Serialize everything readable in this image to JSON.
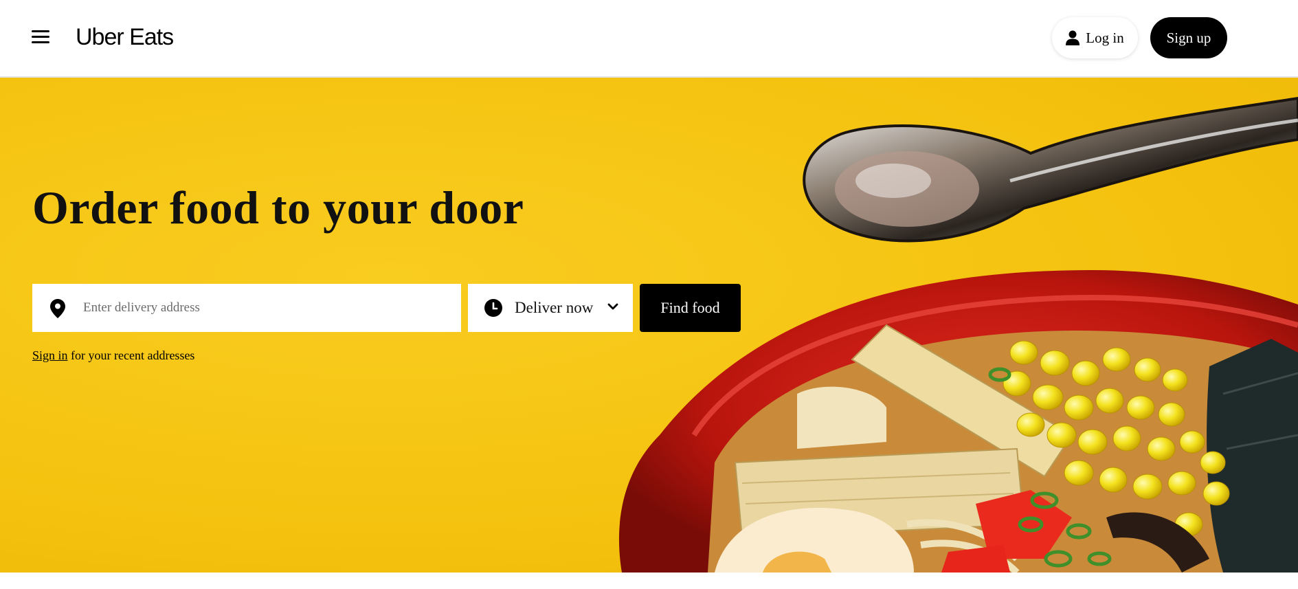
{
  "header": {
    "brand": "Uber Eats",
    "login_label": "Log in",
    "signup_label": "Sign up",
    "menu_icon": "hamburger-menu-icon",
    "login_icon": "person-icon"
  },
  "hero": {
    "title": "Order food to your door",
    "address_placeholder": "Enter delivery address",
    "address_value": "",
    "address_icon": "location-pin-icon",
    "time_label": "Deliver now",
    "time_icon": "clock-icon",
    "time_dropdown_icon": "chevron-down-icon",
    "find_label": "Find food",
    "signin_link": "Sign in",
    "signin_suffix": "for your recent addresses",
    "background_color": "#f6c511"
  },
  "colors": {
    "primary": "#000000",
    "on_primary": "#ffffff",
    "hero_yellow": "#f6c511",
    "bowl_red": "#c0160e"
  }
}
